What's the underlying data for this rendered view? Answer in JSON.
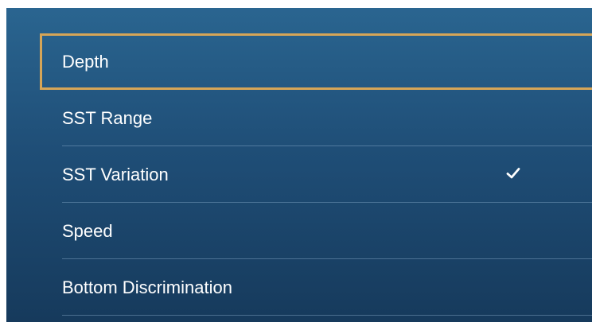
{
  "menu": {
    "items": [
      {
        "label": "Depth",
        "selected": true,
        "checked": false
      },
      {
        "label": "SST Range",
        "selected": false,
        "checked": false
      },
      {
        "label": "SST Variation",
        "selected": false,
        "checked": true
      },
      {
        "label": "Speed",
        "selected": false,
        "checked": false
      },
      {
        "label": "Bottom Discrimination",
        "selected": false,
        "checked": false
      }
    ]
  },
  "icons": {
    "check": "checkmark-icon"
  },
  "colors": {
    "panel_top": "#2a6590",
    "panel_bottom": "#163a5c",
    "selection_border": "#d6a557",
    "text": "#ffffff"
  }
}
